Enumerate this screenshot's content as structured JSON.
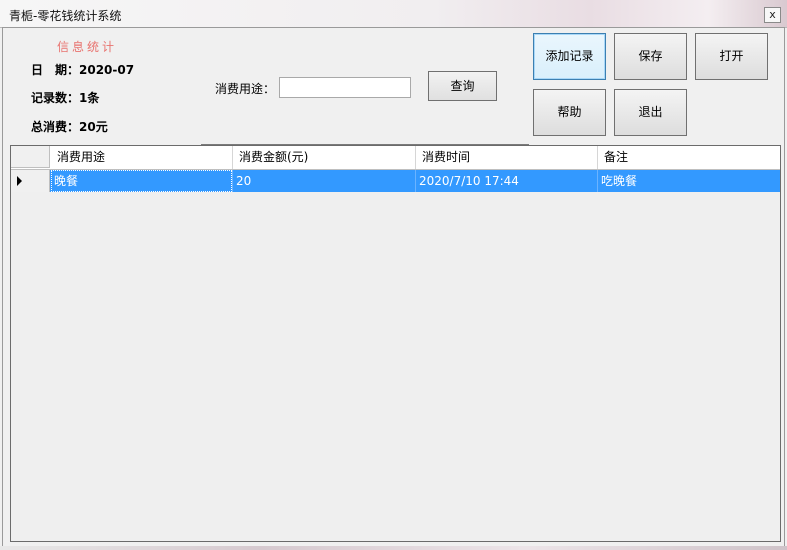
{
  "window": {
    "title": "青栀-零花钱统计系统",
    "close_label": "x"
  },
  "info": {
    "heading": "信息统计",
    "date_line": "日　期：2020-07",
    "count_line": "记录数：1条",
    "total_line": "总消费：20元"
  },
  "search": {
    "label": "消费用途：",
    "value": "",
    "placeholder": "",
    "button": "查询"
  },
  "buttons": {
    "add": "添加记录",
    "save": "保存",
    "open": "打开",
    "help": "帮助",
    "exit": "退出"
  },
  "grid": {
    "columns": [
      "消费用途",
      "消费金额(元)",
      "消费时间",
      "备注"
    ],
    "rows": [
      {
        "purpose": "晚餐",
        "amount": "20",
        "time": "2020/7/10 17:44",
        "note": "吃晚餐",
        "selected": true
      }
    ]
  },
  "colors": {
    "selection": "#3399ff",
    "info_heading": "#e8736f"
  }
}
